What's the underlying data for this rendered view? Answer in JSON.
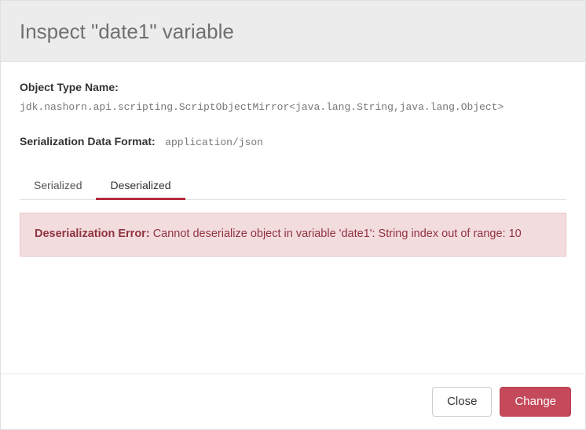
{
  "header": {
    "title": "Inspect \"date1\" variable"
  },
  "body": {
    "object_type_label": "Object Type Name:",
    "object_type_value": "jdk.nashorn.api.scripting.ScriptObjectMirror<java.lang.String,java.lang.Object>",
    "serialization_label": "Serialization Data Format:",
    "serialization_value": "application/json",
    "tabs": {
      "serialized": "Serialized",
      "deserialized": "Deserialized"
    },
    "error": {
      "label": "Deserialization Error:",
      "message": "Cannot deserialize object in variable 'date1': String index out of range: 10"
    }
  },
  "footer": {
    "close": "Close",
    "change": "Change"
  }
}
